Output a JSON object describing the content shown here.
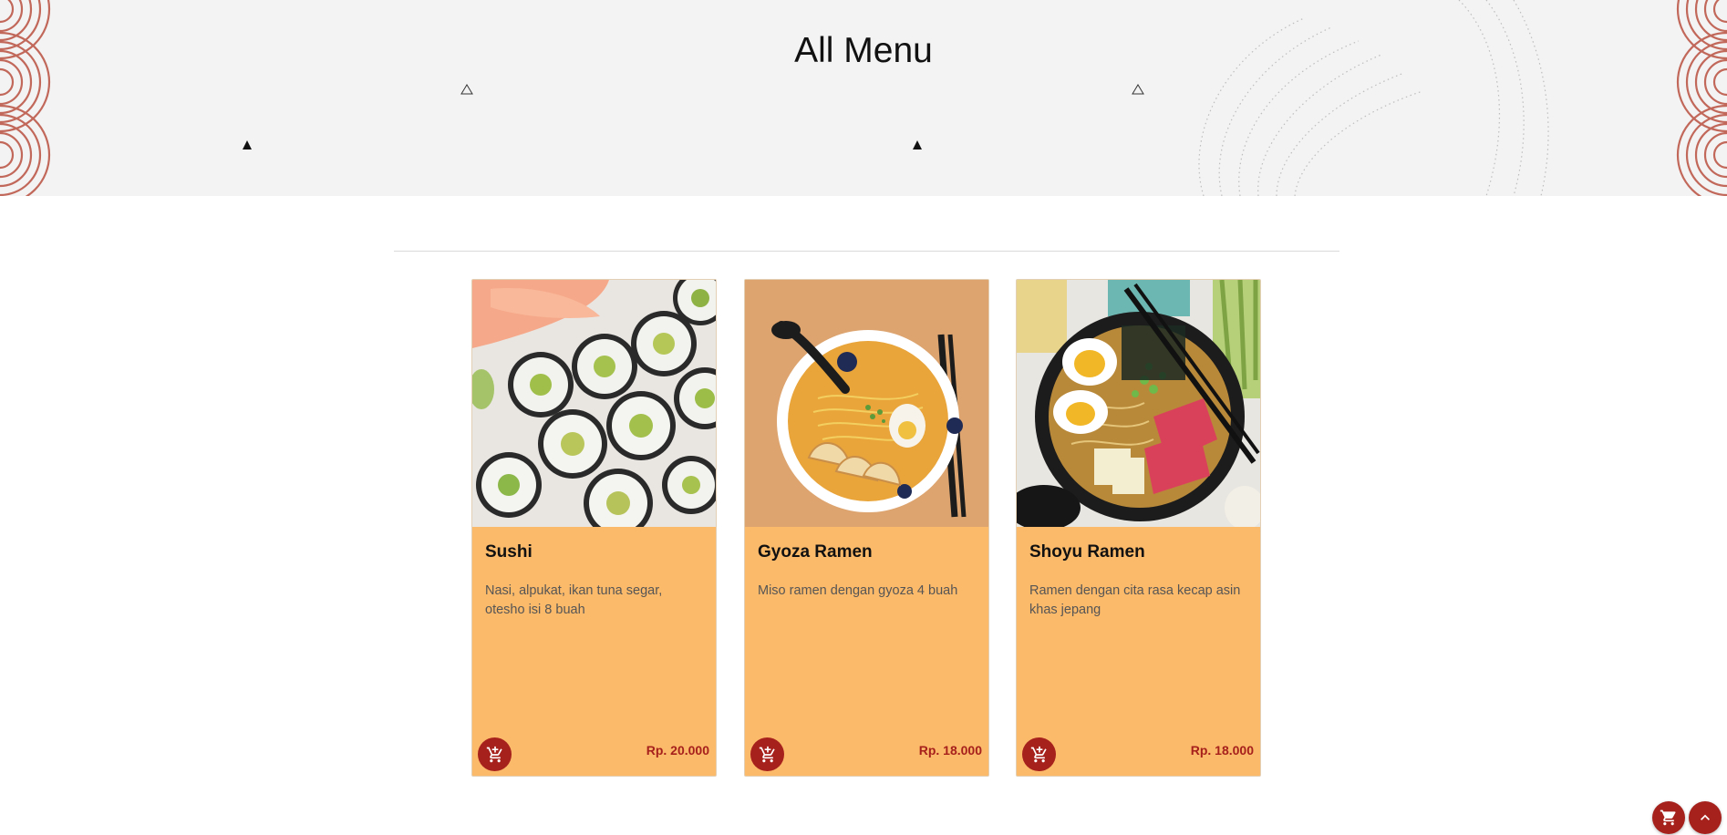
{
  "hero": {
    "title": "All Menu"
  },
  "menu": {
    "items": [
      {
        "name": "Sushi",
        "description": "Nasi, alpukat, ikan tuna segar, otesho isi 8 buah",
        "price": "Rp. 20.000",
        "cart_icon": "add-cart-icon"
      },
      {
        "name": "Gyoza Ramen",
        "description": "Miso ramen dengan gyoza 4 buah",
        "price": "Rp. 18.000",
        "cart_icon": "add-cart-icon"
      },
      {
        "name": "Shoyu Ramen",
        "description": "Ramen dengan cita rasa kecap asin khas jepang",
        "price": "Rp. 18.000",
        "cart_icon": "add-cart-icon"
      }
    ]
  },
  "floating": {
    "cart_icon": "cart-icon",
    "up_icon": "chevron-up-icon"
  },
  "colors": {
    "accent": "#a6201c",
    "card_bg": "#fbb96a",
    "hero_bg": "#f3f3f3",
    "wave": "#c2685a"
  }
}
